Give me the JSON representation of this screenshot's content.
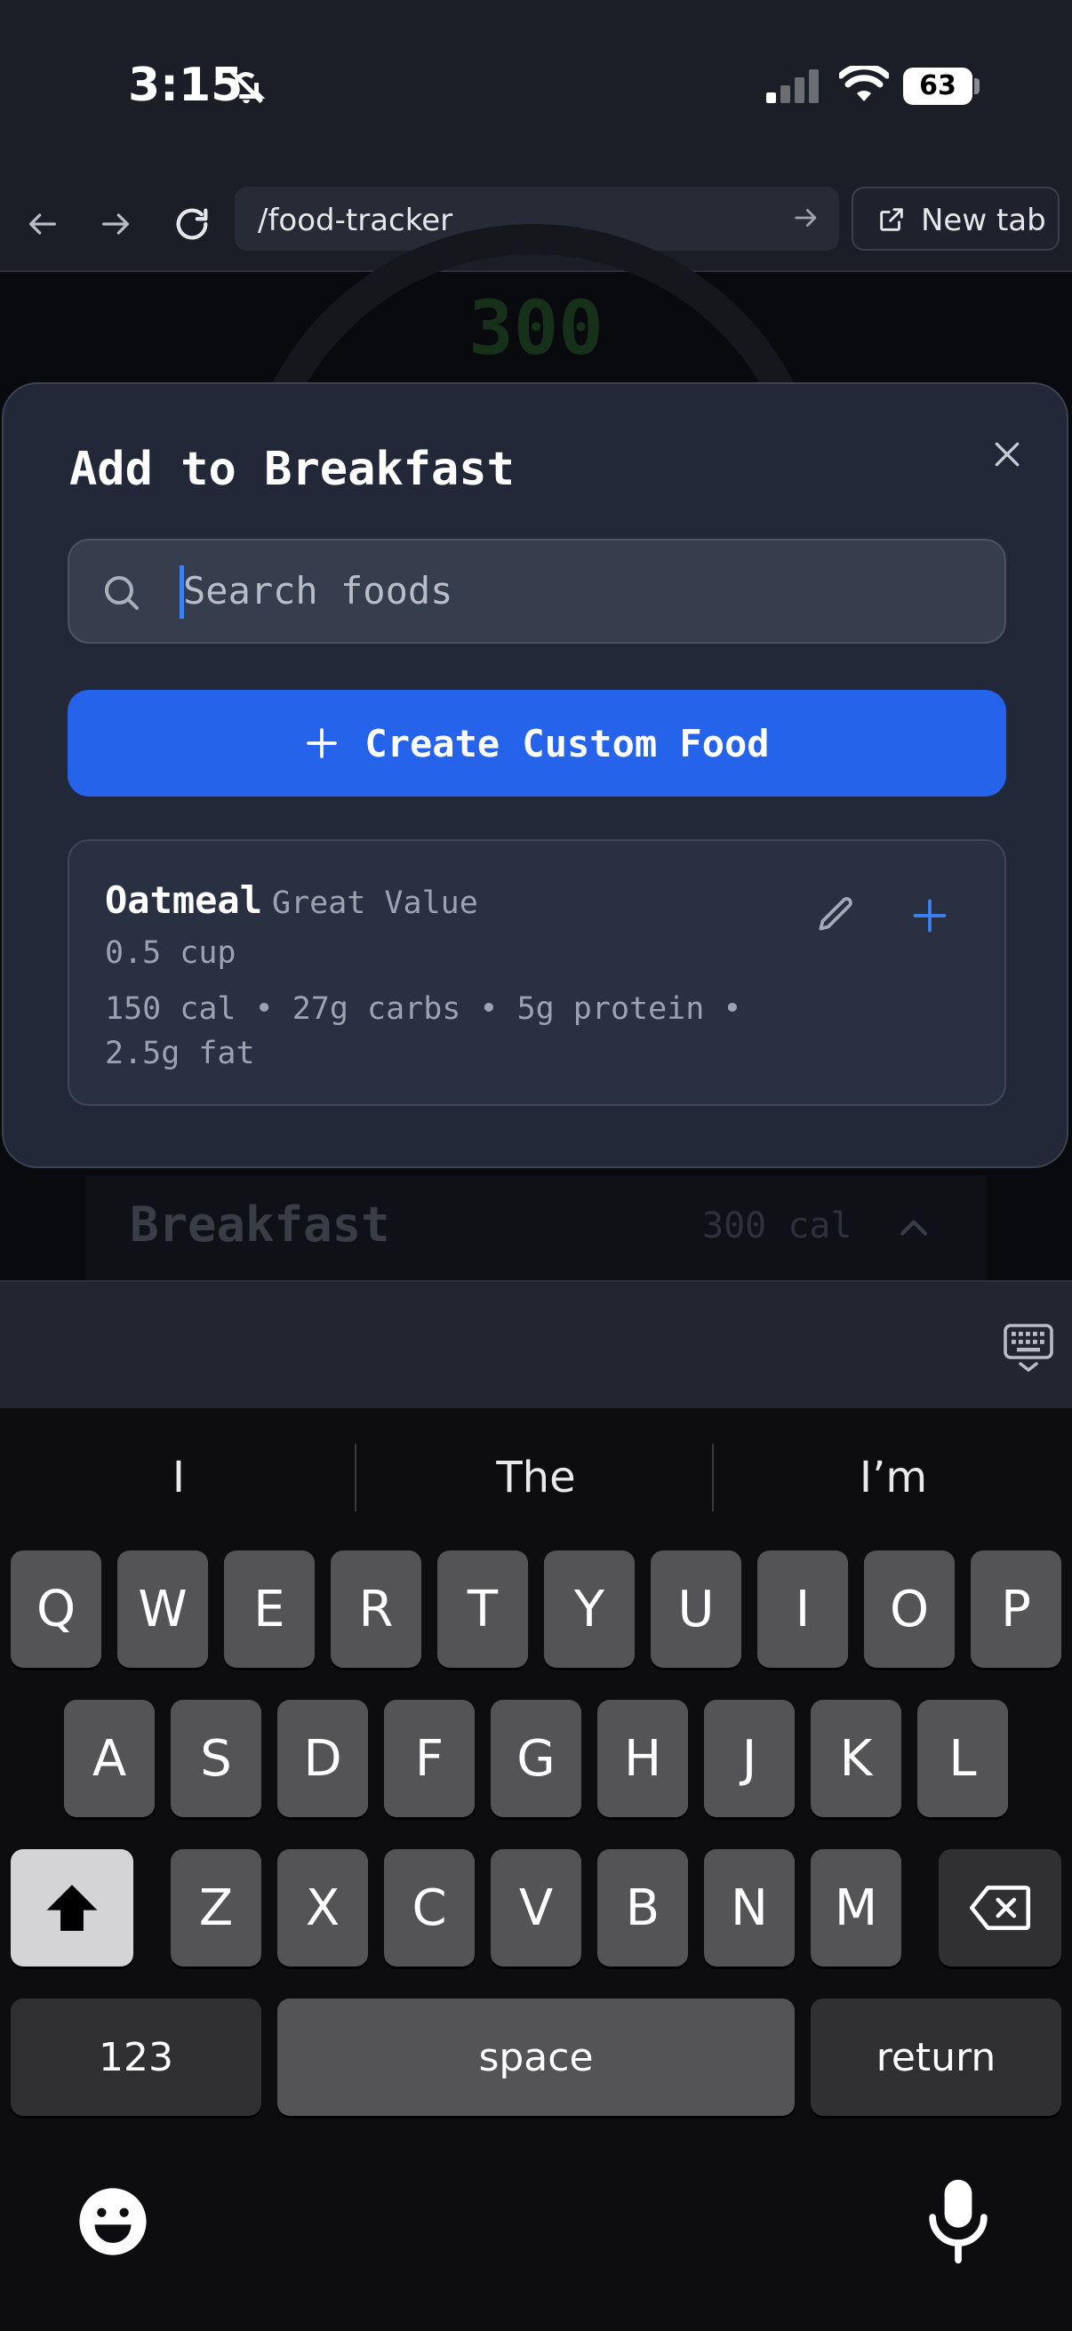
{
  "status_bar": {
    "time": "3:15",
    "battery": "63"
  },
  "browser": {
    "url": "/food-tracker",
    "new_tab_label": "New tab"
  },
  "background": {
    "calories_center": "300",
    "meal": {
      "title": "Breakfast",
      "calories": "300 cal"
    }
  },
  "modal": {
    "title": "Add to Breakfast",
    "search_placeholder": "Search foods",
    "create_label": "Create Custom Food",
    "food": {
      "name": "Oatmeal",
      "brand": "Great Value",
      "serving": "0.5 cup",
      "macros": "150 cal • 27g carbs • 5g protein • 2.5g fat"
    }
  },
  "keyboard": {
    "predictions": [
      "I",
      "The",
      "I’m"
    ],
    "row1": [
      "Q",
      "W",
      "E",
      "R",
      "T",
      "Y",
      "U",
      "I",
      "O",
      "P"
    ],
    "row2": [
      "A",
      "S",
      "D",
      "F",
      "G",
      "H",
      "J",
      "K",
      "L"
    ],
    "row3": [
      "Z",
      "X",
      "C",
      "V",
      "B",
      "N",
      "M"
    ],
    "numbers_label": "123",
    "space_label": "space",
    "return_label": "return"
  },
  "colors": {
    "accent": "#2563eb",
    "modal_bg": "#222838",
    "keyboard_key": "#545456"
  }
}
